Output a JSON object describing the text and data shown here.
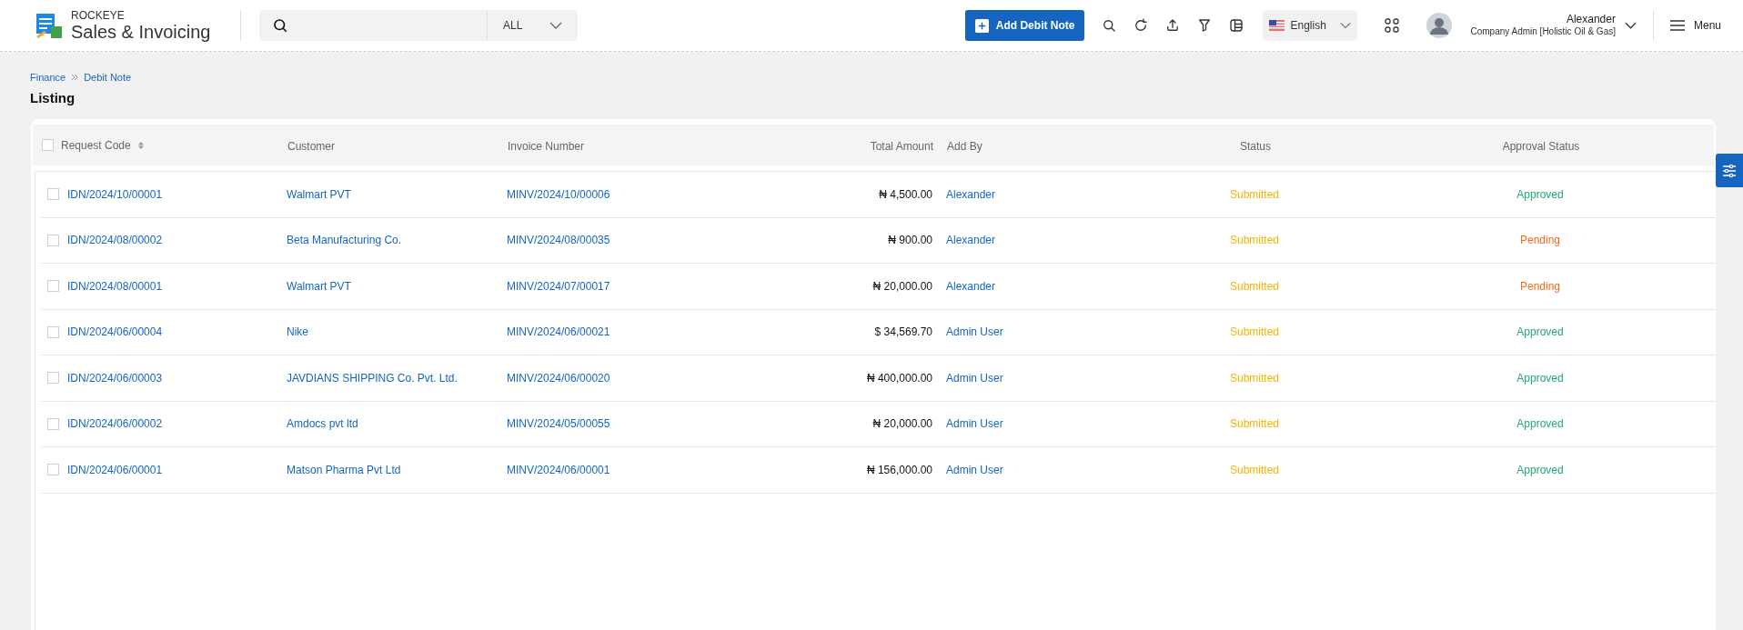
{
  "header": {
    "brand_top": "ROCKEYE",
    "brand_name": "Sales & Invoicing",
    "search": {
      "scope": "ALL"
    },
    "add_button": "Add Debit Note",
    "language": "English",
    "user": {
      "name": "Alexander",
      "role": "Company Admin [Holistic Oil & Gas]"
    },
    "menu": "Menu"
  },
  "breadcrumb": [
    "Finance",
    "Debit Note"
  ],
  "page_title": "Listing",
  "table": {
    "select_all": {
      "checked": false
    },
    "columns": [
      "Request Code",
      "Customer",
      "Invoice Number",
      "Total Amount",
      "Add By",
      "Status",
      "Approval Status"
    ],
    "rows": [
      {
        "checked": false,
        "request_code": "IDN/2024/10/00001",
        "customer": "Walmart PVT",
        "invoice_number": "MINV/2024/10/00006",
        "total_amount": "₦ 4,500.00",
        "add_by": "Alexander",
        "status": "Submitted",
        "approval_status": {
          "text": "Approved",
          "color": "#1faa6f"
        }
      },
      {
        "checked": false,
        "request_code": "IDN/2024/08/00002",
        "customer": "Beta Manufacturing Co.",
        "invoice_number": "MINV/2024/08/00035",
        "total_amount": "₦ 900.00",
        "add_by": "Alexander",
        "status": "Submitted",
        "approval_status": {
          "text": "Pending",
          "color": "#f26b1d"
        }
      },
      {
        "checked": false,
        "request_code": "IDN/2024/08/00001",
        "customer": "Walmart PVT",
        "invoice_number": "MINV/2024/07/00017",
        "total_amount": "₦ 20,000.00",
        "add_by": "Alexander",
        "status": "Submitted",
        "approval_status": {
          "text": "Pending",
          "color": "#f26b1d"
        }
      },
      {
        "checked": false,
        "request_code": "IDN/2024/06/00004",
        "customer": "Nike",
        "invoice_number": "MINV/2024/06/00021",
        "total_amount": "$ 34,569.70",
        "add_by": "Admin User",
        "status": "Submitted",
        "approval_status": {
          "text": "Approved",
          "color": "#1faa6f"
        }
      },
      {
        "checked": false,
        "request_code": "IDN/2024/06/00003",
        "customer": "JAVDIANS SHIPPING Co. Pvt. Ltd.",
        "invoice_number": "MINV/2024/06/00020",
        "total_amount": "₦ 400,000.00",
        "add_by": "Admin User",
        "status": "Submitted",
        "approval_status": {
          "text": "Approved",
          "color": "#1faa6f"
        }
      },
      {
        "checked": false,
        "request_code": "IDN/2024/06/00002",
        "customer": "Amdocs pvt ltd",
        "invoice_number": "MINV/2024/05/00055",
        "total_amount": "₦ 20,000.00",
        "add_by": "Admin User",
        "status": "Submitted",
        "approval_status": {
          "text": "Approved",
          "color": "#1faa6f"
        }
      },
      {
        "checked": false,
        "request_code": "IDN/2024/06/00001",
        "customer": "Matson Pharma Pvt Ltd",
        "invoice_number": "MINV/2024/06/00001",
        "total_amount": "₦ 156,000.00",
        "add_by": "Admin User",
        "status": "Submitted",
        "approval_status": {
          "text": "Approved",
          "color": "#1faa6f"
        }
      }
    ]
  }
}
